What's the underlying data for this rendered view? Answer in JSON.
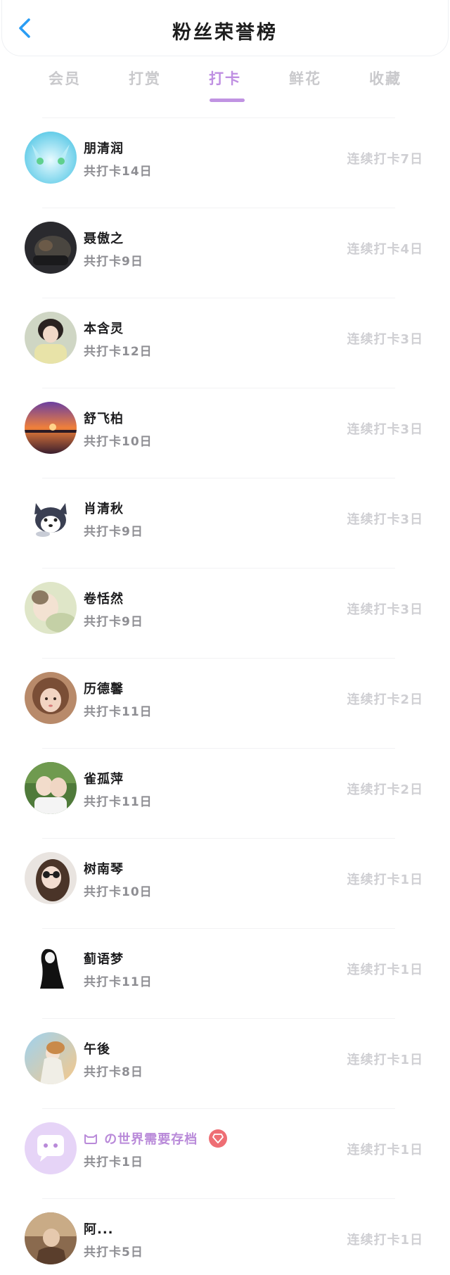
{
  "header": {
    "title": "粉丝荣誉榜",
    "back_icon": "chevron-left-icon",
    "accent": "#2a9df4"
  },
  "tabs": [
    {
      "label": "会员",
      "active": false
    },
    {
      "label": "打赏",
      "active": false
    },
    {
      "label": "打卡",
      "active": true
    },
    {
      "label": "鲜花",
      "active": false
    },
    {
      "label": "收藏",
      "active": false
    }
  ],
  "accent_color": "#bf8fe2",
  "fans": [
    {
      "name": "朋清润",
      "total": "共打卡14日",
      "streak": "连续打卡7日"
    },
    {
      "name": "聂傲之",
      "total": "共打卡9日",
      "streak": "连续打卡4日"
    },
    {
      "name": "本含灵",
      "total": "共打卡12日",
      "streak": "连续打卡3日"
    },
    {
      "name": "舒飞柏",
      "total": "共打卡10日",
      "streak": "连续打卡3日"
    },
    {
      "name": "肖清秋",
      "total": "共打卡9日",
      "streak": "连续打卡3日"
    },
    {
      "name": "卷恬然",
      "total": "共打卡9日",
      "streak": "连续打卡3日"
    },
    {
      "name": "历德馨",
      "total": "共打卡11日",
      "streak": "连续打卡2日"
    },
    {
      "name": "雀孤萍",
      "total": "共打卡11日",
      "streak": "连续打卡2日"
    },
    {
      "name": "树南琴",
      "total": "共打卡10日",
      "streak": "连续打卡1日"
    },
    {
      "name": "蓟语梦",
      "total": "共打卡11日",
      "streak": "连续打卡1日"
    },
    {
      "name": "午後",
      "total": "共打卡8日",
      "streak": "连续打卡1日"
    },
    {
      "name": "の世界需要存档",
      "total": "共打卡1日",
      "streak": "连续打卡1日",
      "special": true
    },
    {
      "name": "阿...",
      "total": "共打卡5日",
      "streak": "连续打卡1日"
    }
  ]
}
